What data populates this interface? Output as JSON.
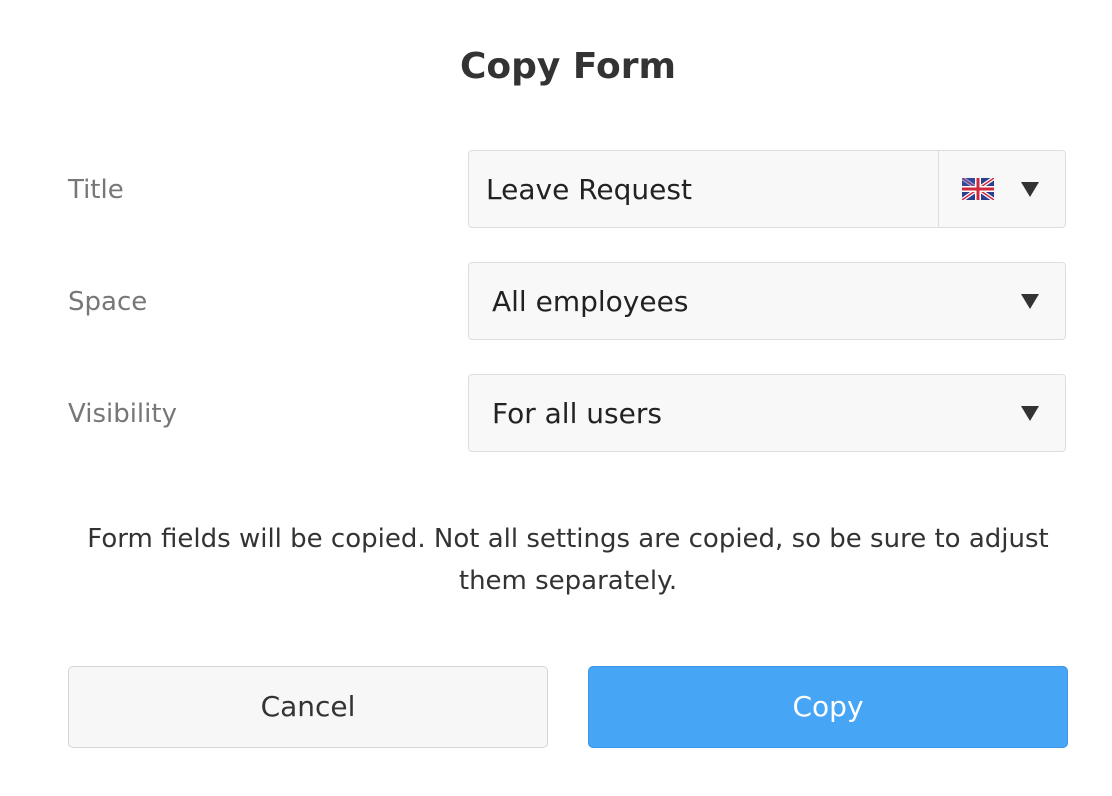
{
  "dialog": {
    "title": "Copy Form"
  },
  "form": {
    "title": {
      "label": "Title",
      "value": "Leave Request",
      "language_icon": "uk-flag-icon"
    },
    "space": {
      "label": "Space",
      "selected": "All employees"
    },
    "visibility": {
      "label": "Visibility",
      "selected": "For all users"
    }
  },
  "note": "Form fields will be copied. Not all settings are copied, so be sure to adjust them separately.",
  "buttons": {
    "cancel_label": "Cancel",
    "copy_label": "Copy"
  },
  "colors": {
    "primary": "#46a5f5",
    "field_background": "#f8f8f8",
    "field_border": "#dddddd",
    "label_text": "#777777"
  }
}
